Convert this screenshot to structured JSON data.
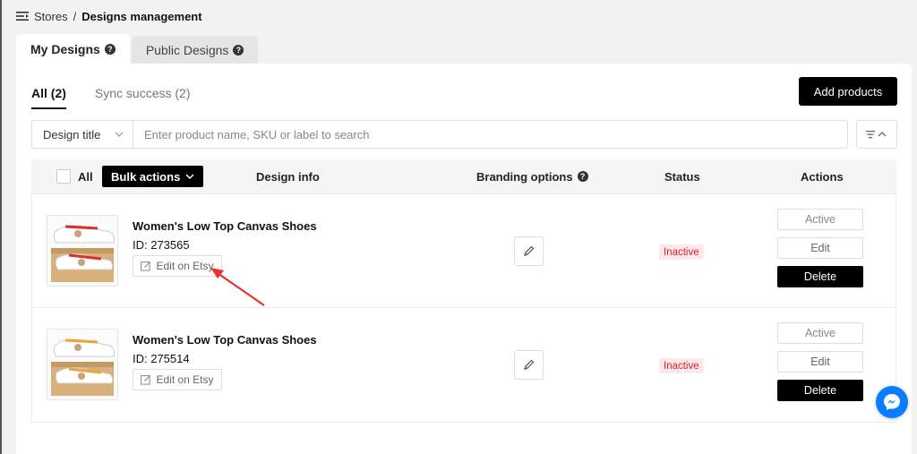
{
  "breadcrumb": {
    "parent": "Stores",
    "separator": "/",
    "current": "Designs management"
  },
  "top_tabs": [
    {
      "label": "My Designs",
      "active": true
    },
    {
      "label": "Public Designs",
      "active": false
    }
  ],
  "sub_tabs": [
    {
      "label": "All (2)",
      "active": true
    },
    {
      "label": "Sync success (2)",
      "active": false
    }
  ],
  "add_products_label": "Add products",
  "search": {
    "select_value": "Design title",
    "placeholder": "Enter product name, SKU or label to search"
  },
  "table": {
    "all_label": "All",
    "bulk_actions_label": "Bulk actions",
    "headers": {
      "design_info": "Design info",
      "branding_options": "Branding options",
      "status": "Status",
      "actions": "Actions"
    }
  },
  "rows": [
    {
      "title": "Women's Low Top Canvas Shoes",
      "id_text": "ID: 273565",
      "etsy_label": "Edit on Etsy",
      "status": "Inactive",
      "actions": {
        "active": "Active",
        "edit": "Edit",
        "delete": "Delete"
      },
      "accent_color": "#d9302c"
    },
    {
      "title": "Women's Low Top Canvas Shoes",
      "id_text": "ID: 275514",
      "etsy_label": "Edit on Etsy",
      "status": "Inactive",
      "actions": {
        "active": "Active",
        "edit": "Edit",
        "delete": "Delete"
      },
      "accent_color": "#e8a53a"
    }
  ],
  "colors": {
    "primary": "#000000",
    "status_inactive": "#e0202a",
    "messenger": "#0a7cff",
    "annotation_arrow": "#e8322c"
  },
  "icons": [
    "menu-icon",
    "help-icon",
    "chevron-down-icon",
    "sort-icon",
    "edit-square-icon",
    "pencil-icon",
    "messenger-icon"
  ]
}
